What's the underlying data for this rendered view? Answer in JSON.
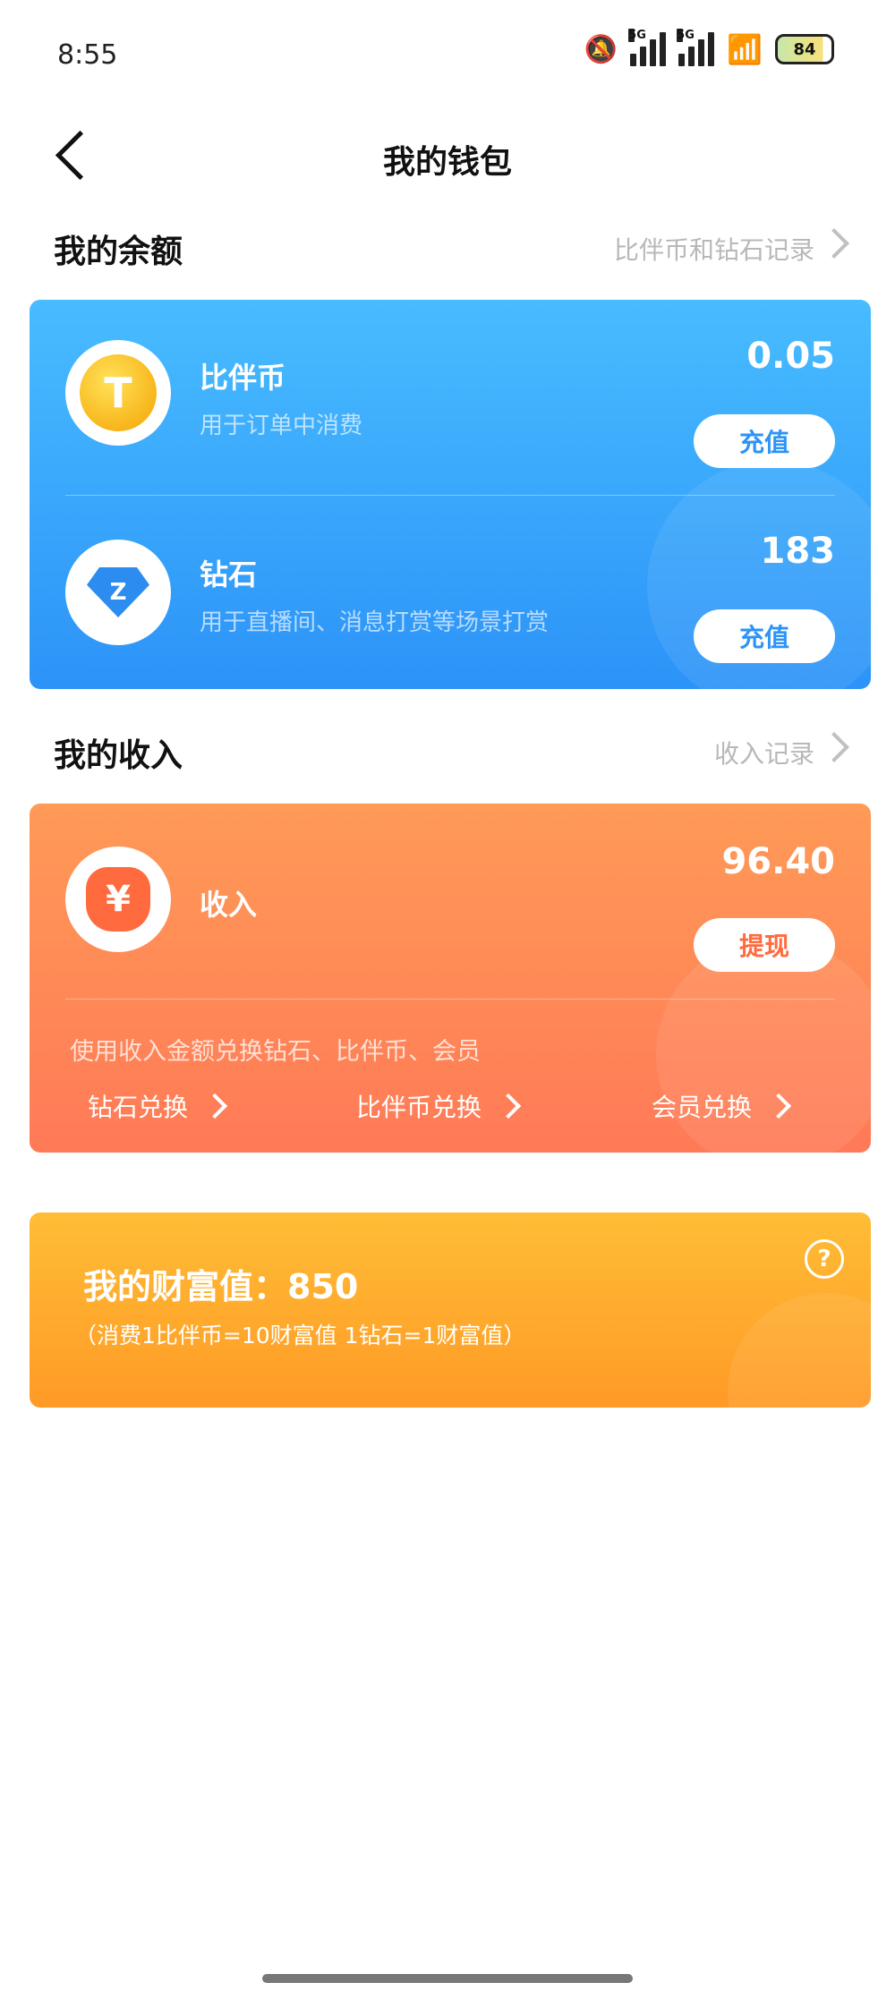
{
  "status": {
    "time": "8:55",
    "network": "5G",
    "battery": "84"
  },
  "nav": {
    "title": "我的钱包"
  },
  "balance": {
    "title": "我的余额",
    "link": "比伴币和钻石记录",
    "coin": {
      "icon_letter": "T",
      "name": "比伴币",
      "desc": "用于订单中消费",
      "amount": "0.05",
      "button": "充值"
    },
    "diamond": {
      "icon_letter": "Z",
      "name": "钻石",
      "desc": "用于直播间、消息打赏等场景打赏",
      "amount": "183",
      "button": "充值"
    }
  },
  "income": {
    "title": "我的收入",
    "link": "收入记录",
    "icon_symbol": "¥",
    "name": "收入",
    "amount": "96.40",
    "button": "提现",
    "desc": "使用收入金额兑换钻石、比伴币、会员",
    "exchanges": [
      "钻石兑换",
      "比伴币兑换",
      "会员兑换"
    ]
  },
  "wealth": {
    "title": "我的财富值：850",
    "note": "（消费1比伴币=10财富值 1钻石=1财富值）",
    "help": "?"
  },
  "colors": {
    "blue": "#2c93f8",
    "orange": "#ff7a57",
    "gold": "#ffa526"
  }
}
